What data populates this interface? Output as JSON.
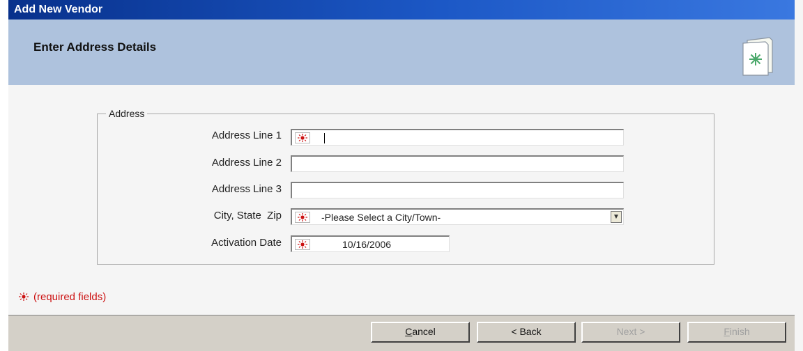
{
  "window": {
    "title": "Add New Vendor"
  },
  "header": {
    "title": "Enter Address Details",
    "icon": "wizard-page-icon"
  },
  "address_group": {
    "legend": "Address",
    "fields": [
      {
        "label": "Address Line 1",
        "value": "",
        "required": true
      },
      {
        "label": "Address Line 2",
        "value": "",
        "required": false
      },
      {
        "label": "Address Line 3",
        "value": "",
        "required": false
      },
      {
        "label": "City, State  Zip",
        "selected": "-Please Select a City/Town-",
        "required": true
      },
      {
        "label": "Activation Date",
        "value": "10/16/2006",
        "required": true
      }
    ]
  },
  "required_note": "(required fields)",
  "buttons": {
    "cancel": {
      "mnemonic": "C",
      "rest": "ancel"
    },
    "back": "< Back",
    "next": "Next >",
    "finish": {
      "mnemonic": "F",
      "rest": "inish"
    }
  },
  "colors": {
    "title_bar": "#08318c",
    "header_band": "#aec2dd",
    "required_marker": "#cc1111",
    "footer": "#d4d0c8"
  }
}
